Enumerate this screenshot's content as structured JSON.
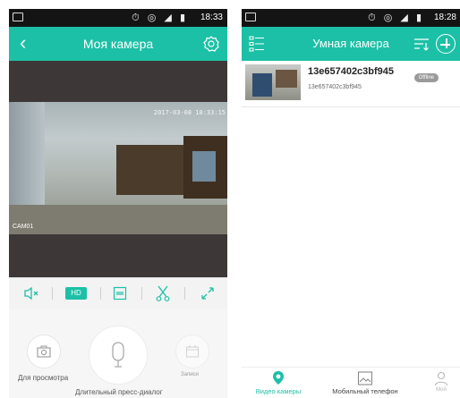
{
  "colors": {
    "accent": "#1cc0a6",
    "status_bar": "#141414",
    "video_bg": "#3d3837",
    "text_dark": "#222222"
  },
  "left_phone": {
    "status_bar": {
      "icons": "⏱ ◎ ◢ ▮",
      "time": "18:33"
    },
    "app_bar": {
      "back_icon": "chevron-left-icon",
      "title": "Моя камера",
      "settings_icon": "camera-settings-icon"
    },
    "video": {
      "timestamp_overlay": "2017-03-08 18:33:15",
      "camera_label": "CAM01"
    },
    "controls": {
      "mute_icon": "speaker-mute-icon",
      "hd_label": "HD",
      "record_icon": "record-icon",
      "cut_icon": "scissors-icon",
      "fullscreen_icon": "expand-icon"
    },
    "actions": {
      "snapshot_label": "Для просмотра",
      "talk_label": "Длительный пресс-диалог",
      "playback_label": "Записи"
    }
  },
  "right_phone": {
    "status_bar": {
      "icons": "⏱ ◎ ◢ ▮",
      "time": "18:28"
    },
    "app_bar": {
      "menu_icon": "menu-list-icon",
      "title": "Умная камера",
      "sort_icon": "sort-icon",
      "add_icon": "add-circle-icon"
    },
    "devices": [
      {
        "name": "13e657402c3bf945",
        "uid": "13e657402c3bf945",
        "status": "Offline"
      }
    ],
    "bottom_nav": [
      {
        "label": "Видео камеры",
        "icon": "location-pin-icon",
        "active": true
      },
      {
        "label": "Мобильный телефон",
        "icon": "image-icon",
        "active": false
      },
      {
        "label": "Мой",
        "icon": "user-icon",
        "active": false
      }
    ]
  }
}
